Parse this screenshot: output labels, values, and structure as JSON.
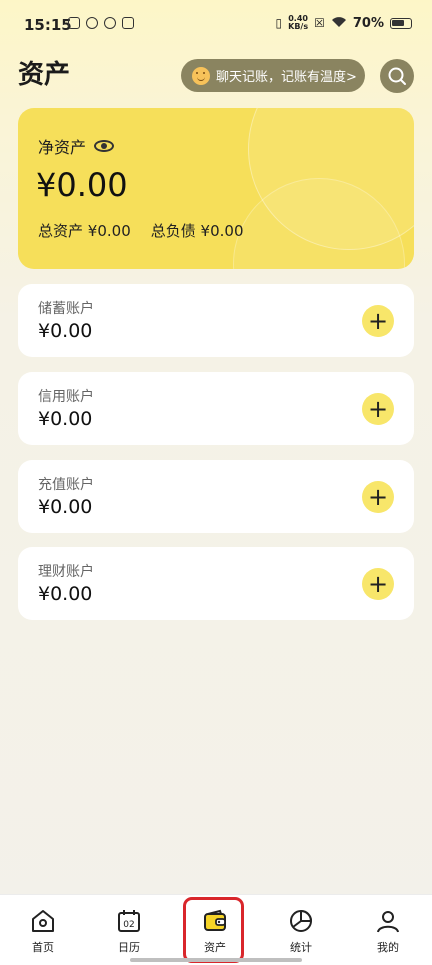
{
  "status_bar": {
    "time": "15:15",
    "net_speed_value": "0.40",
    "net_speed_unit": "KB/s",
    "battery": "70%"
  },
  "header": {
    "title": "资产",
    "chat_prompt": "聊天记账，记账有温度>",
    "search_icon": "search-icon"
  },
  "net_assets": {
    "label": "净资产",
    "value": "¥0.00",
    "total_assets_label": "总资产",
    "total_assets_value": "¥0.00",
    "total_liabilities_label": "总负债",
    "total_liabilities_value": "¥0.00",
    "visibility_icon": "eye-icon"
  },
  "accounts": [
    {
      "name": "储蓄账户",
      "value": "¥0.00"
    },
    {
      "name": "信用账户",
      "value": "¥0.00"
    },
    {
      "name": "充值账户",
      "value": "¥0.00"
    },
    {
      "name": "理财账户",
      "value": "¥0.00"
    }
  ],
  "bottom_nav": {
    "items": [
      {
        "label": "首页",
        "icon": "home-icon"
      },
      {
        "label": "日历",
        "icon": "calendar-icon",
        "icon_text": "02"
      },
      {
        "label": "资产",
        "icon": "wallet-icon",
        "active": true
      },
      {
        "label": "统计",
        "icon": "pie-chart-icon"
      },
      {
        "label": "我的",
        "icon": "user-icon"
      }
    ]
  },
  "colors": {
    "accent_yellow": "#f6df5a",
    "pill_bg": "#8a8460",
    "highlight_red": "#d9262b"
  }
}
